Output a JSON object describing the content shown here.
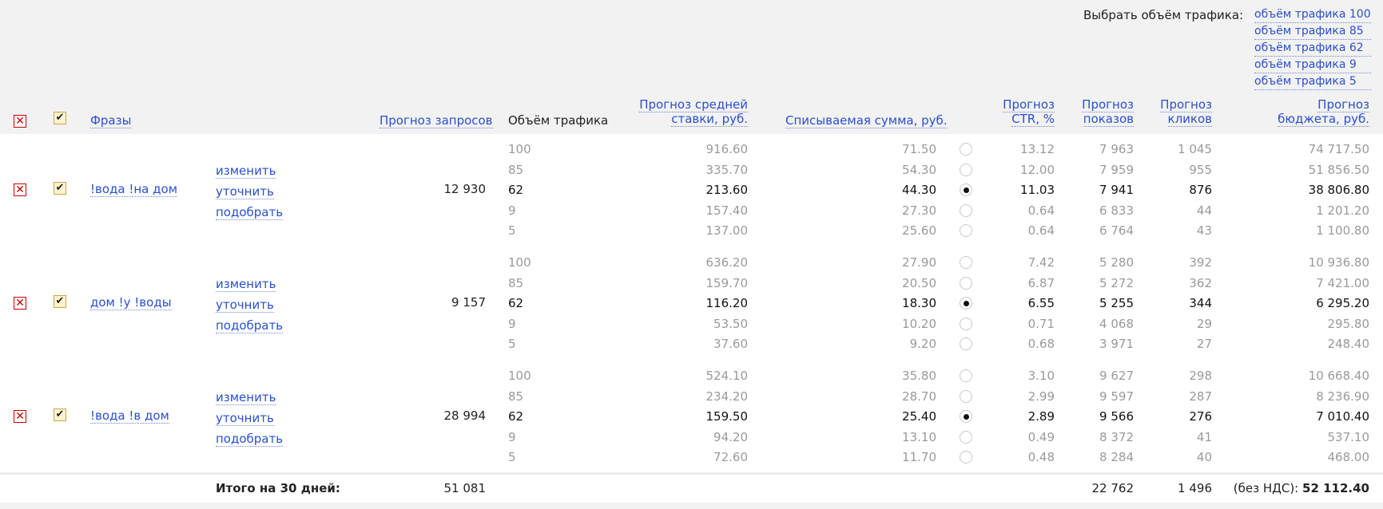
{
  "header": {
    "select_traffic_label": "Выбрать объём трафика:",
    "traffic_options": [
      "объём трафика 100",
      "объём трафика 85",
      "объём трафика 62",
      "объём трафика 9",
      "объём трафика 5"
    ],
    "col_phrases": "Фразы",
    "col_requests": "Прогноз запросов",
    "col_volume": "Объём трафика",
    "col_bid_1": "Прогноз средней",
    "col_bid_2": "ставки, руб.",
    "col_charge": "Списываемая сумма, руб.",
    "col_ctr_1": "Прогноз",
    "col_ctr_2": "CTR, %",
    "col_impr_1": "Прогноз",
    "col_impr_2": "показов",
    "col_clicks_1": "Прогноз",
    "col_clicks_2": "кликов",
    "col_budget_1": "Прогноз",
    "col_budget_2": "бюджета, руб."
  },
  "icons": {
    "remove": "x-icon",
    "checkbox": "check-icon"
  },
  "actions": {
    "edit": "изменить",
    "refine": "уточнить",
    "pick": "подобрать"
  },
  "groups": [
    {
      "phrase": "!вода !на дом",
      "requests": "12 930",
      "rows": [
        {
          "volume": "100",
          "bid": "916.60",
          "charge": "71.50",
          "ctr": "13.12",
          "impr": "7 963",
          "clicks": "1 045",
          "budget": "74 717.50",
          "selected": false
        },
        {
          "volume": "85",
          "bid": "335.70",
          "charge": "54.30",
          "ctr": "12.00",
          "impr": "7 959",
          "clicks": "955",
          "budget": "51 856.50",
          "selected": false
        },
        {
          "volume": "62",
          "bid": "213.60",
          "charge": "44.30",
          "ctr": "11.03",
          "impr": "7 941",
          "clicks": "876",
          "budget": "38 806.80",
          "selected": true
        },
        {
          "volume": "9",
          "bid": "157.40",
          "charge": "27.30",
          "ctr": "0.64",
          "impr": "6 833",
          "clicks": "44",
          "budget": "1 201.20",
          "selected": false
        },
        {
          "volume": "5",
          "bid": "137.00",
          "charge": "25.60",
          "ctr": "0.64",
          "impr": "6 764",
          "clicks": "43",
          "budget": "1 100.80",
          "selected": false
        }
      ]
    },
    {
      "phrase": "дом !у !воды",
      "requests": "9 157",
      "rows": [
        {
          "volume": "100",
          "bid": "636.20",
          "charge": "27.90",
          "ctr": "7.42",
          "impr": "5 280",
          "clicks": "392",
          "budget": "10 936.80",
          "selected": false
        },
        {
          "volume": "85",
          "bid": "159.70",
          "charge": "20.50",
          "ctr": "6.87",
          "impr": "5 272",
          "clicks": "362",
          "budget": "7 421.00",
          "selected": false
        },
        {
          "volume": "62",
          "bid": "116.20",
          "charge": "18.30",
          "ctr": "6.55",
          "impr": "5 255",
          "clicks": "344",
          "budget": "6 295.20",
          "selected": true
        },
        {
          "volume": "9",
          "bid": "53.50",
          "charge": "10.20",
          "ctr": "0.71",
          "impr": "4 068",
          "clicks": "29",
          "budget": "295.80",
          "selected": false
        },
        {
          "volume": "5",
          "bid": "37.60",
          "charge": "9.20",
          "ctr": "0.68",
          "impr": "3 971",
          "clicks": "27",
          "budget": "248.40",
          "selected": false
        }
      ]
    },
    {
      "phrase": "!вода !в дом",
      "requests": "28 994",
      "rows": [
        {
          "volume": "100",
          "bid": "524.10",
          "charge": "35.80",
          "ctr": "3.10",
          "impr": "9 627",
          "clicks": "298",
          "budget": "10 668.40",
          "selected": false
        },
        {
          "volume": "85",
          "bid": "234.20",
          "charge": "28.70",
          "ctr": "2.99",
          "impr": "9 597",
          "clicks": "287",
          "budget": "8 236.90",
          "selected": false
        },
        {
          "volume": "62",
          "bid": "159.50",
          "charge": "25.40",
          "ctr": "2.89",
          "impr": "9 566",
          "clicks": "276",
          "budget": "7 010.40",
          "selected": true
        },
        {
          "volume": "9",
          "bid": "94.20",
          "charge": "13.10",
          "ctr": "0.49",
          "impr": "8 372",
          "clicks": "41",
          "budget": "537.10",
          "selected": false
        },
        {
          "volume": "5",
          "bid": "72.60",
          "charge": "11.70",
          "ctr": "0.48",
          "impr": "8 284",
          "clicks": "40",
          "budget": "468.00",
          "selected": false
        }
      ]
    }
  ],
  "totals": {
    "label": "Итого на 30 дней:",
    "requests": "51 081",
    "impr": "22 762",
    "clicks": "1 496",
    "budget_prefix": "(без НДС):",
    "budget": "52 112.40"
  }
}
